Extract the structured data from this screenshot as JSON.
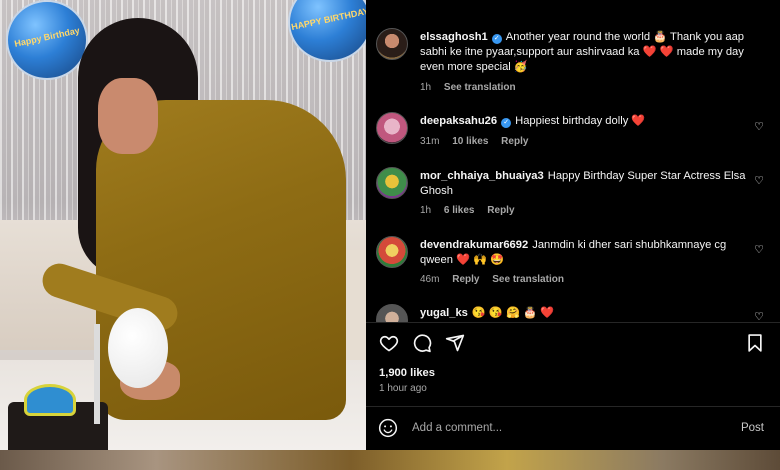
{
  "comments": [
    {
      "username": "elssaghosh1",
      "verified": true,
      "text": "Another year round the world 🎂 Thank you aap sabhi ke itne pyaar,support aur ashirvaad ka ❤️ ❤️ made my day even more special 🥳",
      "time": "1h",
      "likes": "",
      "reply": "",
      "translation": "See translation"
    },
    {
      "username": "deepaksahu26",
      "verified": true,
      "text": "Happiest birthday dolly ❤️",
      "time": "31m",
      "likes": "10 likes",
      "reply": "Reply",
      "translation": ""
    },
    {
      "username": "mor_chhaiya_bhuaiya3",
      "verified": false,
      "text": "Happy Birthday Super Star Actress Elsa Ghosh",
      "time": "1h",
      "likes": "6 likes",
      "reply": "Reply",
      "translation": ""
    },
    {
      "username": "devendrakumar6692",
      "verified": false,
      "text": "Janmdin ki dher sari shubhkamnaye cg qween ❤️ 🙌 🤩",
      "time": "46m",
      "likes": "",
      "reply": "Reply",
      "translation": "See translation"
    },
    {
      "username": "yugal_ks",
      "verified": false,
      "text": "😘 😘 🤗 🎂 ❤️",
      "time": "",
      "likes": "",
      "reply": "",
      "translation": ""
    }
  ],
  "likes_count": "1,900 likes",
  "posted_ago": "1 hour ago",
  "add_comment_placeholder": "Add a comment...",
  "post_label": "Post",
  "photo": {
    "balloon_left_text": "Happy Birthday",
    "balloon_right_text": "HAPPY BIRTHDAY"
  },
  "icons": {
    "like": "heart-icon",
    "comment": "comment-icon",
    "share": "send-icon",
    "save": "bookmark-icon",
    "emoji": "emoji-icon",
    "comment_like": "heart-icon"
  },
  "colors": {
    "panel_bg": "#000000",
    "text": "#f5f5f5",
    "muted": "#a8a8a8",
    "verified": "#3897f0"
  }
}
